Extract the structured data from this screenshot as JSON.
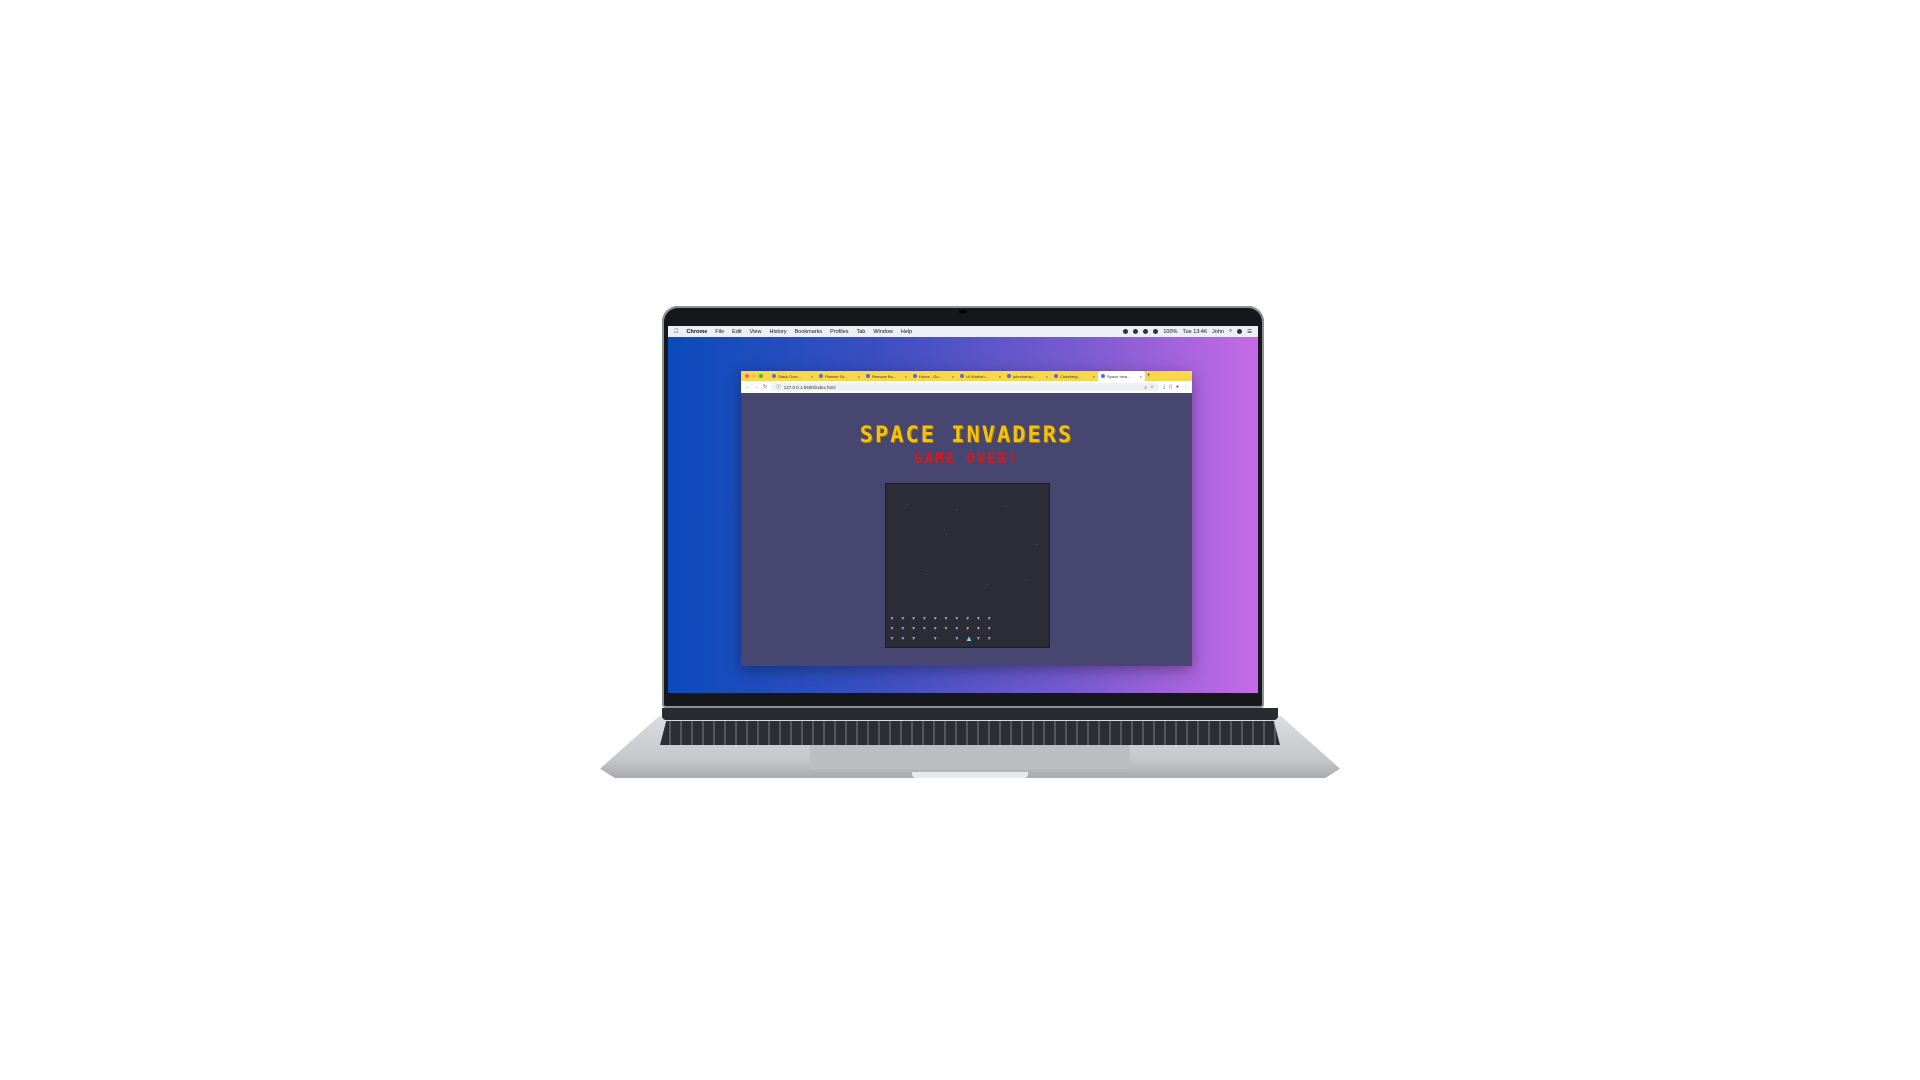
{
  "menubar": {
    "apple": "",
    "app_name": "Chrome",
    "items": [
      "File",
      "Edit",
      "View",
      "History",
      "Bookmarks",
      "Profiles",
      "Tab",
      "Window",
      "Help"
    ],
    "battery": "100%",
    "datetime": "Tue 13:46",
    "user": "John"
  },
  "browser": {
    "tabs": [
      {
        "label": "Stack Over..."
      },
      {
        "label": "Planner Gr..."
      },
      {
        "label": "Remove Bu..."
      },
      {
        "label": "Home - Go..."
      },
      {
        "label": "UI Worksh..."
      },
      {
        "label": "johndoe/sp..."
      },
      {
        "label": "Codeberg..."
      },
      {
        "label": "Space Inva..."
      }
    ],
    "active_tab": 7,
    "url": "127.0.0.1:5500/index.html"
  },
  "game": {
    "title": "SPACE INVADERS",
    "status": "GAME OVER!",
    "colors": {
      "title": "#f5c20b",
      "status": "#e01515",
      "invader": "#b58fd9",
      "ship": "#7ad0ff"
    }
  }
}
